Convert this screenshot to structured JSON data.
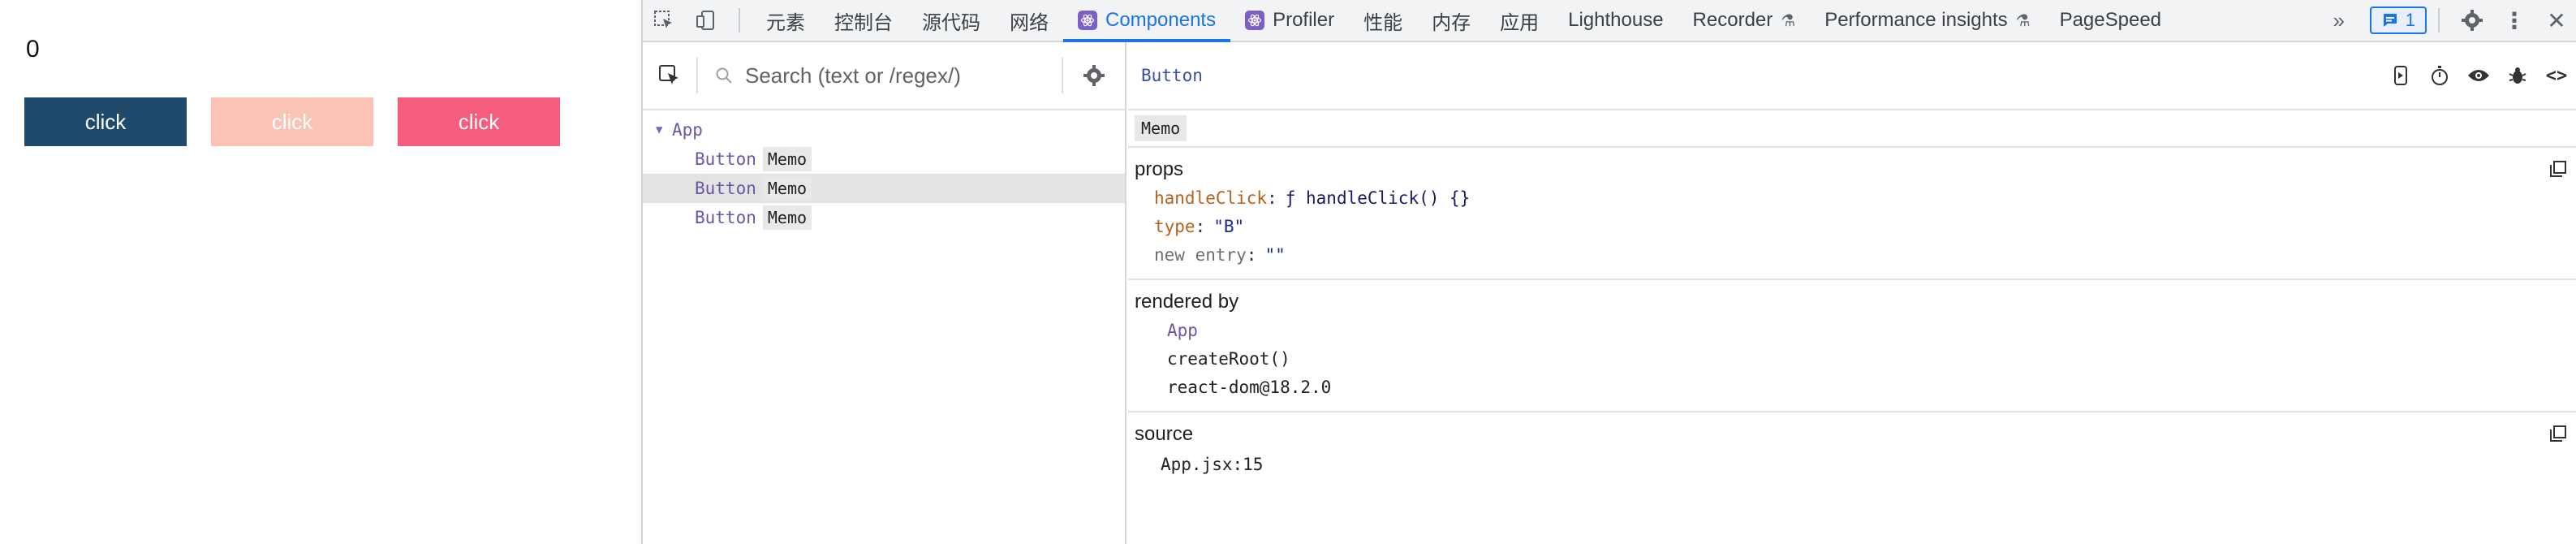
{
  "app": {
    "counter": "0",
    "buttons": [
      {
        "label": "click",
        "color": "#1f4a6b"
      },
      {
        "label": "click",
        "color": "#fbc3b5"
      },
      {
        "label": "click",
        "color": "#f55c7e"
      }
    ]
  },
  "devtools": {
    "tabs": [
      {
        "label": "元素"
      },
      {
        "label": "控制台"
      },
      {
        "label": "源代码"
      },
      {
        "label": "网络"
      },
      {
        "label": "Components",
        "active": true
      },
      {
        "label": "Profiler"
      },
      {
        "label": "性能"
      },
      {
        "label": "内存"
      },
      {
        "label": "应用"
      },
      {
        "label": "Lighthouse"
      },
      {
        "label": "Recorder"
      },
      {
        "label": "Performance insights"
      },
      {
        "label": "PageSpeed"
      }
    ],
    "issues_count": "1",
    "accent": "#1a73e8"
  },
  "tree": {
    "search_placeholder": "Search (text or /regex/)",
    "root": "App",
    "items": [
      {
        "name": "Button",
        "badge": "Memo"
      },
      {
        "name": "Button",
        "badge": "Memo",
        "selected": true
      },
      {
        "name": "Button",
        "badge": "Memo"
      }
    ]
  },
  "details": {
    "component": "Button",
    "badge": "Memo",
    "props_title": "props",
    "props": [
      {
        "key": "handleClick",
        "value": "ƒ handleClick() {}"
      },
      {
        "key": "type",
        "value": "\"B\""
      },
      {
        "key": "new entry",
        "value": "\"\""
      }
    ],
    "rendered_by_title": "rendered by",
    "rendered_by": [
      "App",
      "createRoot()",
      "react-dom@18.2.0"
    ],
    "source_title": "source",
    "source": "App.jsx:15"
  }
}
